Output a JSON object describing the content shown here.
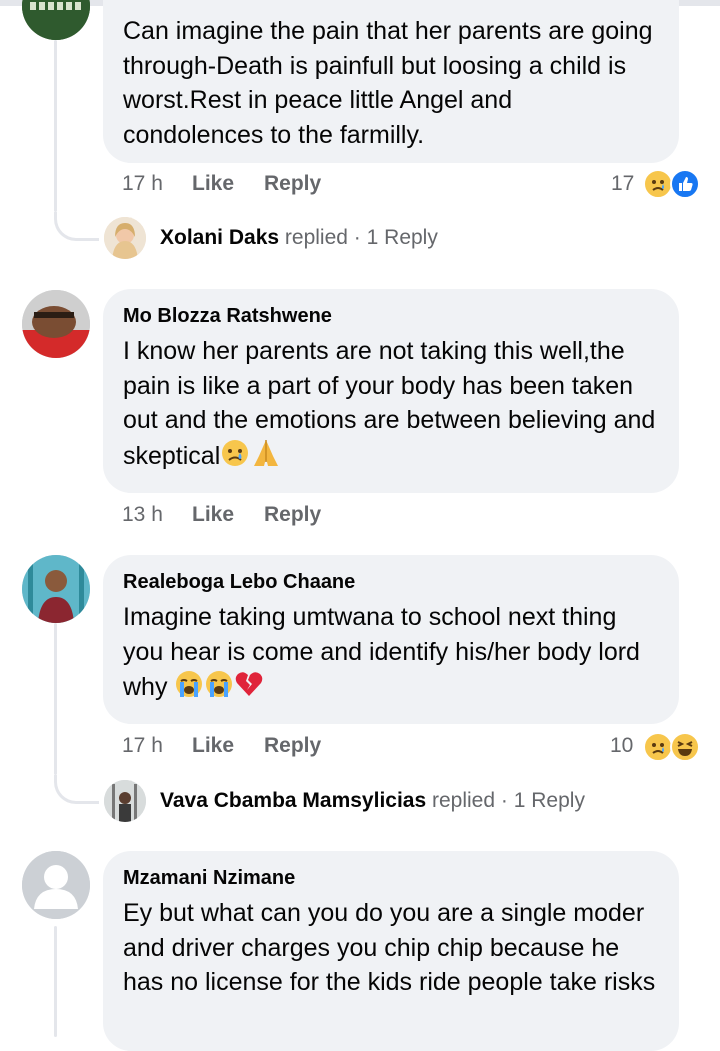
{
  "comments": [
    {
      "author": "",
      "text": "Can imagine the pain that her parents are going through-Death is painfull but loosing a child is worst.Rest in peace little Angel and condolences to the farmilly.",
      "time": "17 h",
      "like_label": "Like",
      "reply_label": "Reply",
      "reaction_count": "17",
      "reactions": [
        "sad",
        "like"
      ],
      "replies": {
        "name": "Xolani Daks",
        "verb": "replied",
        "count_text": "1 Reply"
      }
    },
    {
      "author": "Mo Blozza Ratshwene",
      "text": "I know her parents are not taking this well,the pain is like a part of your body has been taken out and the emotions are between believing and skeptical",
      "text_emojis": [
        "crying-face",
        "folded-hands"
      ],
      "time": "13 h",
      "like_label": "Like",
      "reply_label": "Reply"
    },
    {
      "author": "Realeboga Lebo Chaane",
      "text": "Imagine taking umtwana to school next thing you hear is come and identify his/her body lord why",
      "text_emojis": [
        "loudly-crying-face",
        "loudly-crying-face",
        "broken-heart"
      ],
      "time": "17 h",
      "like_label": "Like",
      "reply_label": "Reply",
      "reaction_count": "10",
      "reactions": [
        "sad",
        "haha"
      ],
      "replies": {
        "name": "Vava Cbamba Mamsylicias",
        "verb": "replied",
        "count_text": "1 Reply"
      }
    },
    {
      "author": "Mzamani Nzimane",
      "text": "Ey but what can you do you are a single moder and driver charges you chip chip because he has no license for the kids ride people take risks"
    }
  ],
  "separator": "·",
  "colors": {
    "bubble": "#f0f2f5",
    "meta": "#65676b",
    "like_blue": "#1877f2",
    "emoji_yellow": "#f7c64c"
  }
}
